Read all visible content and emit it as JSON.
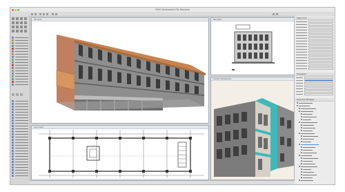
{
  "window": {
    "title": "VWX Vectorworks File Structure"
  },
  "views": {
    "top_left_tab": "3D View",
    "top_right_tab": "Elevation",
    "bottom_left_tab": "Floor Plan",
    "bottom_right_tab": "Section Perspective"
  },
  "panels": {
    "object_info_heading": "Object Info",
    "navigation_heading": "Navigation",
    "resource_heading": "Resource Manager"
  },
  "colors": {
    "accent_blue": "#4a90d9",
    "roof_orange": "#c8834f",
    "section_cut_teal": "#3fb8b8",
    "facade_grey": "#8e8e8e",
    "close_red": "#ee5d55",
    "min_yellow": "#f5be3f",
    "max_green": "#5cc24b"
  }
}
